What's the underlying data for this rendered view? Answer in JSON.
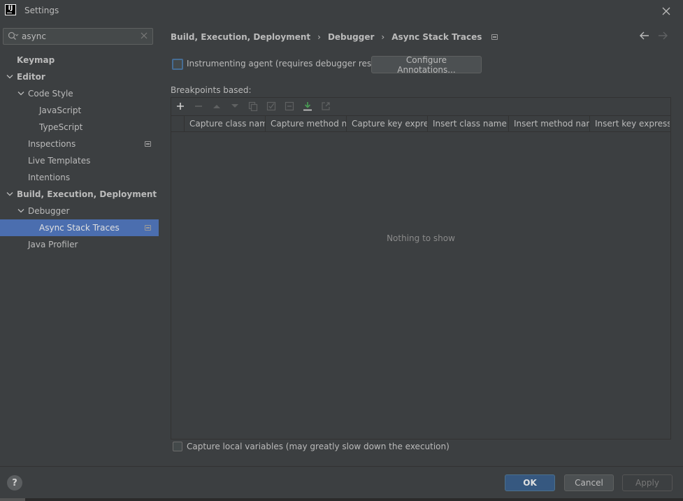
{
  "window": {
    "title": "Settings"
  },
  "search": {
    "value": "async",
    "placeholder": ""
  },
  "sidebar": {
    "items": [
      {
        "label": "Keymap",
        "bold": true,
        "level": 0,
        "expanded": null
      },
      {
        "label": "Editor",
        "bold": true,
        "level": 0,
        "expanded": true
      },
      {
        "label": "Code Style",
        "bold": false,
        "level": 1,
        "expanded": true
      },
      {
        "label": "JavaScript",
        "bold": false,
        "level": 2,
        "expanded": null
      },
      {
        "label": "TypeScript",
        "bold": false,
        "level": 2,
        "expanded": null
      },
      {
        "label": "Inspections",
        "bold": false,
        "level": 1,
        "expanded": null,
        "badge": true
      },
      {
        "label": "Live Templates",
        "bold": false,
        "level": 1,
        "expanded": null
      },
      {
        "label": "Intentions",
        "bold": false,
        "level": 1,
        "expanded": null
      },
      {
        "label": "Build, Execution, Deployment",
        "bold": true,
        "level": 0,
        "expanded": true
      },
      {
        "label": "Debugger",
        "bold": false,
        "level": 1,
        "expanded": true
      },
      {
        "label": "Async Stack Traces",
        "bold": false,
        "level": 2,
        "expanded": null,
        "badge": true,
        "selected": true
      },
      {
        "label": "Java Profiler",
        "bold": false,
        "level": 1,
        "expanded": null
      }
    ]
  },
  "breadcrumb": {
    "items": [
      "Build, Execution, Deployment",
      "Debugger",
      "Async Stack Traces"
    ]
  },
  "main": {
    "agent_checkbox_label": "Instrumenting agent (requires debugger restart)",
    "agent_checked": false,
    "configure_button": "Configure Annotations...",
    "breakpoints_label": "Breakpoints based:",
    "table": {
      "columns": [
        "Capture class name",
        "Capture method n...",
        "Capture key expre...",
        "Insert class name",
        "Insert method name",
        "Insert key expressi..."
      ],
      "rows": [],
      "empty_text": "Nothing to show"
    },
    "local_vars_label": "Capture local variables (may greatly slow down the execution)",
    "local_vars_checked": false
  },
  "footer": {
    "help_label": "?",
    "ok_label": "OK",
    "cancel_label": "Cancel",
    "apply_label": "Apply"
  },
  "colors": {
    "background": "#3c3f41",
    "selection": "#4b6eaf",
    "primary_button": "#365880",
    "add_icon": "#cfcfcf",
    "import_icon": "#499c54"
  },
  "icons": {
    "toolbar": [
      "add-icon",
      "remove-icon",
      "move-up-icon",
      "move-down-icon",
      "copy-icon",
      "check-icon",
      "collapse-icon",
      "import-icon",
      "export-icon"
    ]
  }
}
